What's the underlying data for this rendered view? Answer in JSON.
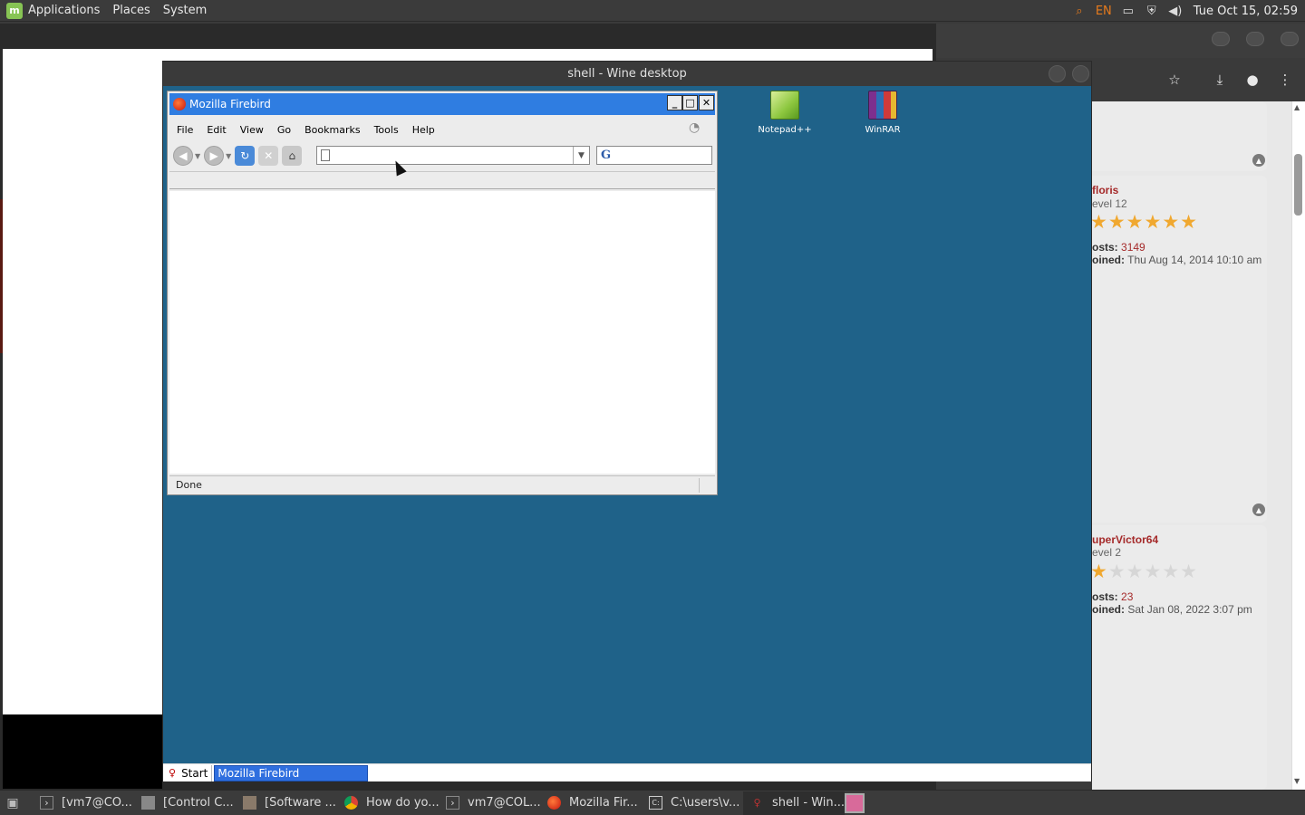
{
  "top_panel": {
    "menus": [
      "Applications",
      "Places",
      "System"
    ],
    "tray": {
      "search_icon": "search-icon",
      "language": "EN",
      "icons": [
        "display-icon",
        "shield-icon",
        "volume-icon"
      ],
      "clock": "Tue Oct 15, 02:59"
    }
  },
  "wine_window": {
    "title": "shell - Wine desktop",
    "desktop_icons": [
      {
        "label": "Notepad++",
        "icon": "notepad-plus-plus-icon"
      },
      {
        "label": "WinRAR",
        "icon": "winrar-icon"
      }
    ],
    "taskbar": {
      "start_label": "Start",
      "tasks": [
        "Mozilla Firebird"
      ]
    }
  },
  "firebird": {
    "title": "Mozilla Firebird",
    "menus": [
      {
        "label": "File"
      },
      {
        "label": "Edit"
      },
      {
        "label": "View"
      },
      {
        "label": "Go"
      },
      {
        "label": "Bookmarks"
      },
      {
        "label": "Tools"
      },
      {
        "label": "Help"
      }
    ],
    "url_value": "",
    "search_value": "",
    "status": "Done"
  },
  "chrome_page": {
    "posts": [
      {
        "user": "floris",
        "rank": "evel 12",
        "stars_filled": 6,
        "stars_total": 6,
        "posts_label": "osts:",
        "posts": "3149",
        "joined_label": "oined:",
        "joined": "Thu Aug 14, 2014 10:10 am"
      },
      {
        "user": "uperVictor64",
        "rank": "evel 2",
        "stars_filled": 1,
        "stars_total": 6,
        "posts_label": "osts:",
        "posts": "23",
        "joined_label": "oined:",
        "joined": "Sat Jan 08, 2022 3:07 pm"
      }
    ]
  },
  "bottom_panel": {
    "tasks": [
      {
        "label": "[vm7@CO...",
        "icon": "terminal-icon"
      },
      {
        "label": "[Control C...",
        "icon": "control-panel-icon"
      },
      {
        "label": "[Software ...",
        "icon": "software-icon"
      },
      {
        "label": "How do yo...",
        "icon": "chrome-icon"
      },
      {
        "label": "vm7@COL...",
        "icon": "terminal-icon"
      },
      {
        "label": "Mozilla Fir...",
        "icon": "firebird-icon"
      },
      {
        "label": "C:\\users\\v...",
        "icon": "wine-console-icon"
      },
      {
        "label": "shell - Win...",
        "icon": "wine-icon"
      }
    ]
  }
}
